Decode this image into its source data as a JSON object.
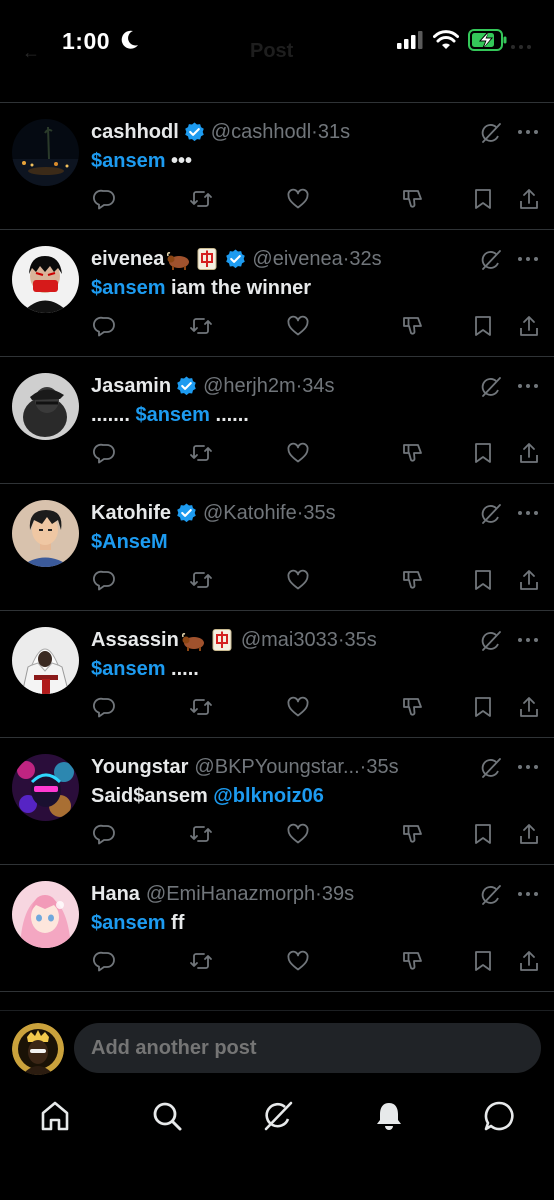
{
  "status_bar": {
    "time": "1:00",
    "faded_title": "Post"
  },
  "posts": [
    {
      "display_name": "cashhodl",
      "badges": [],
      "verified": true,
      "handle": "@cashhodl",
      "time": "·31s",
      "text": [
        {
          "t": "$ansem",
          "kind": "cashtag"
        },
        {
          "t": " •••",
          "kind": "text"
        }
      ]
    },
    {
      "display_name": "eivenea",
      "badges": [
        "ox",
        "mahjong"
      ],
      "verified": true,
      "handle": "@eivenea",
      "time": "·32s",
      "text": [
        {
          "t": "$ansem",
          "kind": "cashtag"
        },
        {
          "t": " iam the winner",
          "kind": "text"
        }
      ]
    },
    {
      "display_name": "Jasamin",
      "badges": [],
      "verified": true,
      "handle": "@herjh2m",
      "time": "·34s",
      "text": [
        {
          "t": "....... ",
          "kind": "text"
        },
        {
          "t": "$ansem",
          "kind": "cashtag"
        },
        {
          "t": " ......",
          "kind": "text"
        }
      ]
    },
    {
      "display_name": "Katohife",
      "badges": [],
      "verified": true,
      "handle": "@Katohife",
      "time": "·35s",
      "text": [
        {
          "t": "$AnseM",
          "kind": "cashtag"
        }
      ]
    },
    {
      "display_name": "Assassin",
      "badges": [
        "ox",
        "mahjong"
      ],
      "verified": false,
      "handle": "@mai3033",
      "time": "·35s",
      "text": [
        {
          "t": "$ansem",
          "kind": "cashtag"
        },
        {
          "t": " .....",
          "kind": "text"
        }
      ]
    },
    {
      "display_name": "Youngstar",
      "badges": [],
      "verified": false,
      "handle": "@BKPYoungstar...",
      "time": "·35s",
      "text": [
        {
          "t": "Said$ansem ",
          "kind": "text"
        },
        {
          "t": "@blknoiz06",
          "kind": "mention"
        }
      ]
    },
    {
      "display_name": "Hana",
      "badges": [],
      "verified": false,
      "handle": "@EmiHanazmorph",
      "time": "·39s",
      "text": [
        {
          "t": "$ansem",
          "kind": "cashtag"
        },
        {
          "t": " ff",
          "kind": "text"
        }
      ]
    }
  ],
  "composer": {
    "placeholder": "Add another post"
  },
  "tab_bar": {
    "tabs": [
      "home-icon",
      "search-icon",
      "grok-icon",
      "notifications-icon",
      "messages-icon"
    ]
  },
  "colors": {
    "background": "#000000",
    "accent": "#1d9bf0",
    "muted": "#71767b",
    "divider": "#2f3336",
    "battery": "#34c759"
  }
}
